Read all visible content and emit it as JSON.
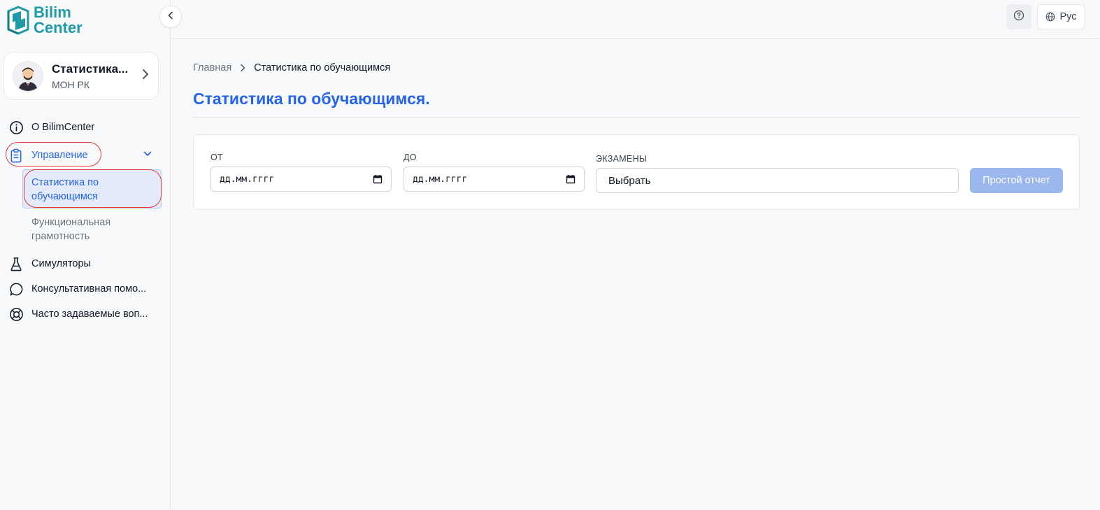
{
  "logo": {
    "line1": "Bilim",
    "line2": "Center"
  },
  "profile": {
    "name": "Статистика...",
    "org": "МОН РК"
  },
  "sidebar": {
    "items": [
      {
        "label": "О BilimCenter",
        "icon": "info-icon"
      },
      {
        "label": "Управление",
        "icon": "clipboard-icon"
      },
      {
        "label": "Симуляторы",
        "icon": "flask-icon"
      },
      {
        "label": "Консультативная помо...",
        "icon": "chat-bubble-icon"
      },
      {
        "label": "Часто задаваемые воп...",
        "icon": "lifebuoy-icon"
      }
    ],
    "sub_items": [
      {
        "label": "Статистика по обучающимся"
      },
      {
        "label": "Функциональная грамотность"
      }
    ]
  },
  "header": {
    "lang_label": "Рус"
  },
  "breadcrumb": {
    "home": "Главная",
    "current": "Статистика по обучающимся"
  },
  "page": {
    "title": "Статистика по обучающимся."
  },
  "filters": {
    "from_label": "ОТ",
    "from_value": "дд.мм.гггг",
    "to_label": "ДО",
    "to_value": "дд.мм.гггг",
    "exams_label": "ЭКЗАМЕНЫ",
    "exams_value": "Выбрать",
    "report_button": "Простой отчет"
  },
  "colors": {
    "accent": "#2563eb",
    "brand": "#1f9aa6",
    "highlight_ring": "#e53935",
    "button_disabled": "#9bb8ee"
  }
}
